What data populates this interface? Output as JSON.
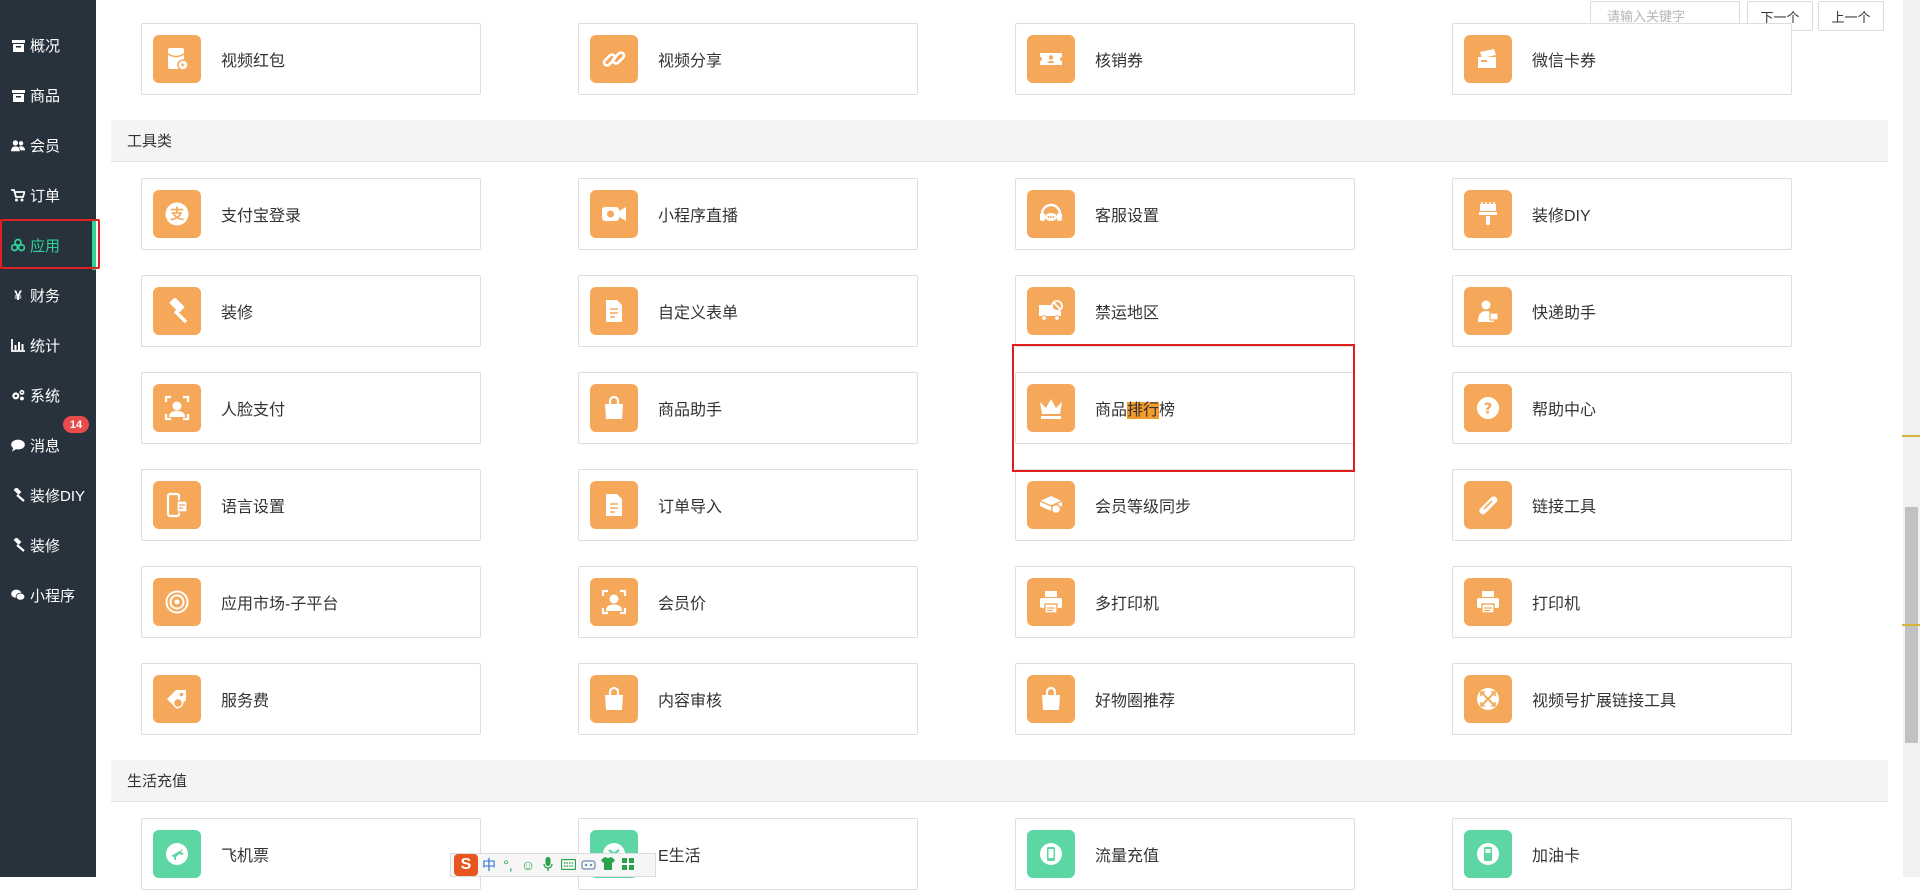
{
  "sidebar": {
    "items": [
      {
        "label": "概况",
        "icon": "archive-icon"
      },
      {
        "label": "商品",
        "icon": "archive-icon"
      },
      {
        "label": "会员",
        "icon": "users-icon"
      },
      {
        "label": "订单",
        "icon": "cart-icon"
      },
      {
        "label": "应用",
        "icon": "cubes-icon",
        "active": true
      },
      {
        "label": "财务",
        "icon": "yen-icon"
      },
      {
        "label": "统计",
        "icon": "bar-chart-icon"
      },
      {
        "label": "系统",
        "icon": "gears-icon"
      },
      {
        "label": "消息",
        "icon": "comment-icon",
        "badge": "14"
      },
      {
        "label": "装修DIY",
        "icon": "gavel-icon"
      },
      {
        "label": "装修",
        "icon": "gavel-icon"
      },
      {
        "label": "小程序",
        "icon": "wechat-icon"
      }
    ]
  },
  "search": {
    "placeholder": "请输入关键字",
    "next_label": "下一个",
    "prev_label": "上一个"
  },
  "top_row": [
    {
      "label": "视频红包",
      "icon": "video-redpacket-icon"
    },
    {
      "label": "视频分享",
      "icon": "link-icon"
    },
    {
      "label": "核销券",
      "icon": "ticket-icon"
    },
    {
      "label": "微信卡券",
      "icon": "card-voucher-icon"
    }
  ],
  "sections": [
    {
      "title": "工具类",
      "rows": [
        [
          {
            "label": "支付宝登录",
            "icon": "alipay-icon"
          },
          {
            "label": "小程序直播",
            "icon": "live-camera-icon"
          },
          {
            "label": "客服设置",
            "icon": "customer-service-icon"
          },
          {
            "label": "装修DIY",
            "icon": "brush-icon"
          }
        ],
        [
          {
            "label": "装修",
            "icon": "hammer-icon"
          },
          {
            "label": "自定义表单",
            "icon": "form-icon"
          },
          {
            "label": "禁运地区",
            "icon": "truck-ban-icon"
          },
          {
            "label": "快递助手",
            "icon": "courier-icon"
          }
        ],
        [
          {
            "label": "人脸支付",
            "icon": "face-pay-icon"
          },
          {
            "label": "商品助手",
            "icon": "bag-icon"
          },
          {
            "label": "商品排行榜",
            "icon": "crown-icon",
            "label_pre": "商品",
            "label_hl": "排行",
            "label_post": "榜"
          },
          {
            "label": "帮助中心",
            "icon": "question-icon"
          }
        ],
        [
          {
            "label": "语言设置",
            "icon": "language-icon"
          },
          {
            "label": "订单导入",
            "icon": "document-icon"
          },
          {
            "label": "会员等级同步",
            "icon": "member-sync-icon"
          },
          {
            "label": "链接工具",
            "icon": "chain-tool-icon"
          }
        ],
        [
          {
            "label": "应用市场-子平台",
            "icon": "target-icon"
          },
          {
            "label": "会员价",
            "icon": "member-price-icon"
          },
          {
            "label": "多打印机",
            "icon": "printer-icon"
          },
          {
            "label": "打印机",
            "icon": "printer-icon"
          }
        ],
        [
          {
            "label": "服务费",
            "icon": "service-fee-icon"
          },
          {
            "label": "内容审核",
            "icon": "bag-icon"
          },
          {
            "label": "好物圈推荐",
            "icon": "bag-icon"
          },
          {
            "label": "视频号扩展链接工具",
            "icon": "expand-icon"
          }
        ]
      ]
    },
    {
      "title": "生活充值",
      "rows": [
        [
          {
            "label": "飞机票",
            "icon": "plane-icon"
          },
          {
            "label": "E生活",
            "icon": "life-icon"
          },
          {
            "label": "流量充值",
            "icon": "phone-data-icon"
          },
          {
            "label": "加油卡",
            "icon": "fuel-icon"
          }
        ]
      ]
    }
  ],
  "colors": {
    "sidebar_bg": "#28323d",
    "accent_active": "#2fd39a",
    "icon_orange": "#f5a85a",
    "icon_green": "#5cd6a3",
    "highlight_red": "#e02020",
    "search_highlight": "#f49b2d"
  },
  "ime_toolbar": {
    "logo": "S",
    "mode": "中",
    "punct": "°,",
    "icons": [
      "smile-icon",
      "mic-icon",
      "keyboard-icon",
      "tool-icon",
      "shirt-icon",
      "grid-icon"
    ]
  }
}
